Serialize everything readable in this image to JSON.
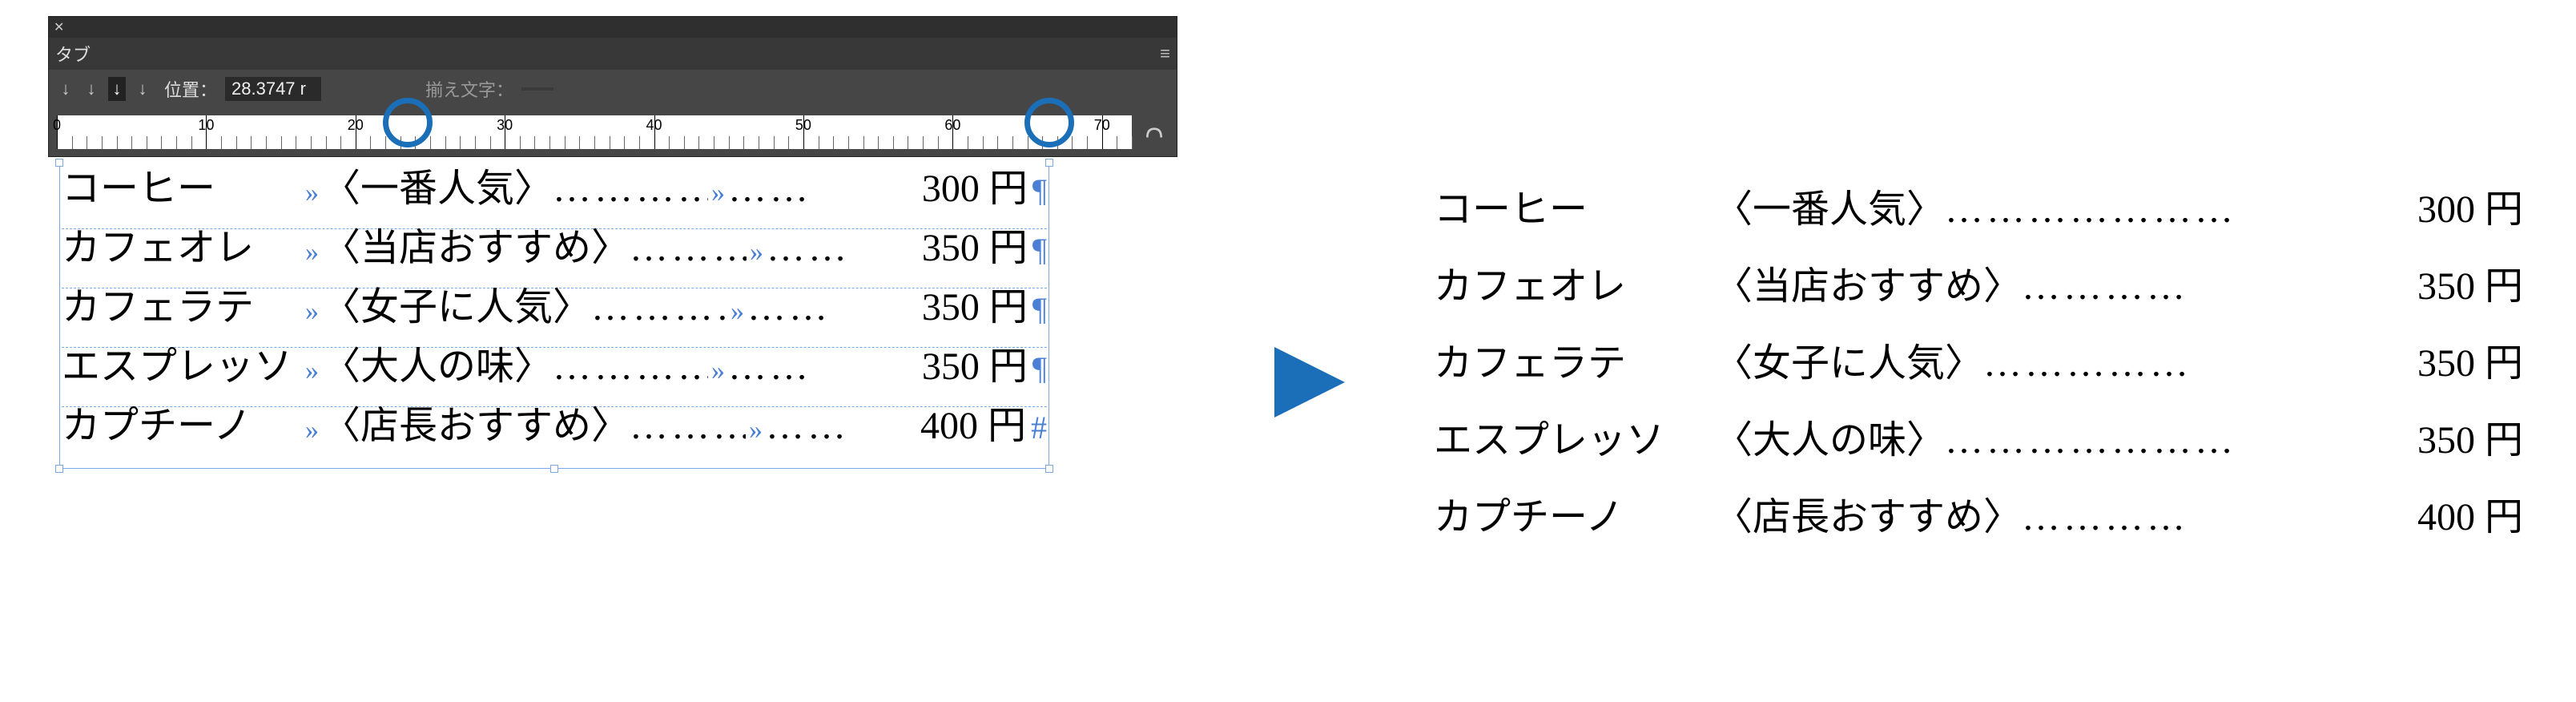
{
  "panel": {
    "title": "タブ",
    "position_label": "位置：",
    "position_value": "28.3747 r",
    "leader_label": "揃え文字：",
    "leader_value": ""
  },
  "ruler": {
    "majors": [
      0,
      10,
      20,
      30,
      40,
      50,
      60,
      70
    ],
    "circles": [
      23.5,
      66.5
    ]
  },
  "menu": {
    "items": [
      {
        "name": "コーヒー",
        "tag": "〈一番人気〉",
        "dots": "…………………",
        "price": "300 円",
        "end": "¶"
      },
      {
        "name": "カフェオレ",
        "tag": "〈当店おすすめ〉",
        "dots": "…………",
        "price": "350 円",
        "end": "¶"
      },
      {
        "name": "カフェラテ",
        "tag": "〈女子に人気〉",
        "dots": "……………",
        "price": "350 円",
        "end": "¶"
      },
      {
        "name": "エスプレッソ",
        "tag": "〈大人の味〉",
        "dots": "…………………",
        "price": "350 円",
        "end": "¶"
      },
      {
        "name": "カプチーノ",
        "tag": "〈店長おすすめ〉",
        "dots": "…………",
        "price": "400 円",
        "end": "#"
      }
    ]
  },
  "menu_clean": {
    "items": [
      {
        "name": "コーヒー",
        "tag": "〈一番人気〉",
        "dots": "…………………",
        "price": "300 円"
      },
      {
        "name": "カフェオレ",
        "tag": "〈当店おすすめ〉",
        "dots": "…………",
        "price": "350 円"
      },
      {
        "name": "カフェラテ",
        "tag": "〈女子に人気〉",
        "dots": "……………",
        "price": "350 円"
      },
      {
        "name": "エスプレッソ",
        "tag": "〈大人の味〉",
        "dots": "…………………",
        "price": "350 円"
      },
      {
        "name": "カプチーノ",
        "tag": "〈店長おすすめ〉",
        "dots": "…………",
        "price": "400 円"
      }
    ]
  }
}
